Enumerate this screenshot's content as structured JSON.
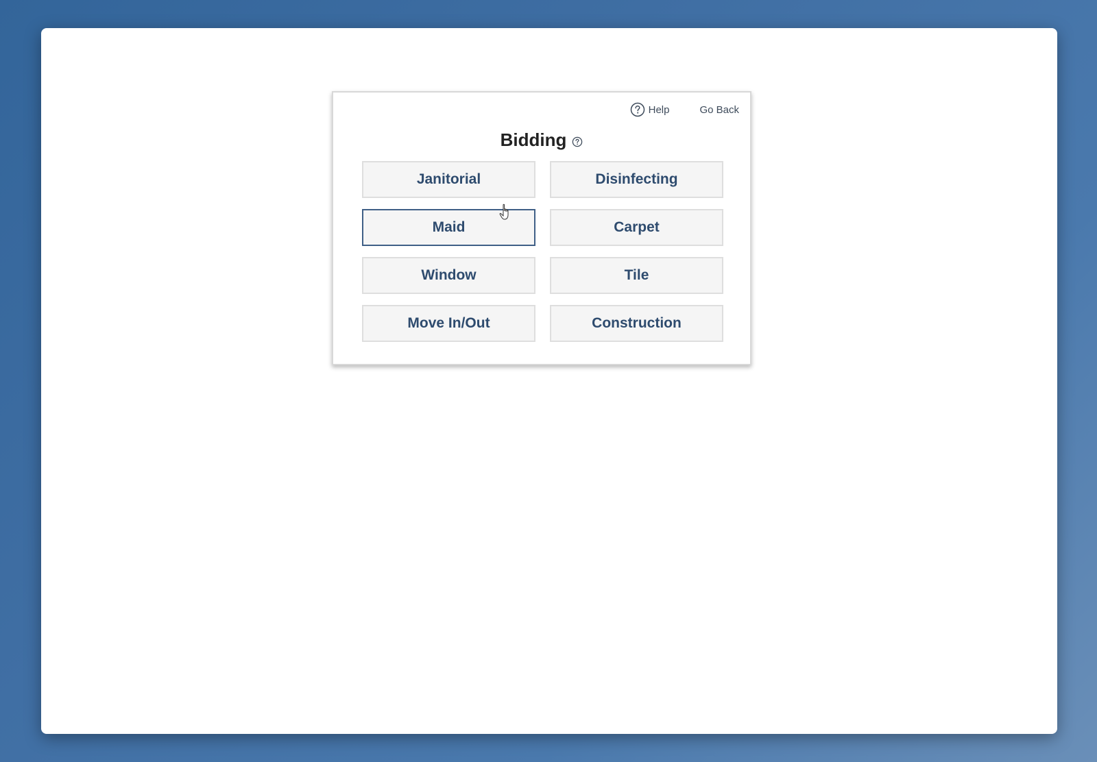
{
  "header": {
    "help_label": "Help",
    "go_back_label": "Go Back"
  },
  "page": {
    "title": "Bidding"
  },
  "services": [
    {
      "label": "Janitorial"
    },
    {
      "label": "Disinfecting"
    },
    {
      "label": "Maid"
    },
    {
      "label": "Carpet"
    },
    {
      "label": "Window"
    },
    {
      "label": "Tile"
    },
    {
      "label": "Move In/Out"
    },
    {
      "label": "Construction"
    }
  ],
  "colors": {
    "background": "#3f6ea3",
    "button_text": "#2e4b6e",
    "button_bg": "#f5f5f5",
    "active_border": "#3f5f86"
  },
  "icons": {
    "help": "question-circle-icon",
    "cursor": "hand-pointer-icon"
  }
}
